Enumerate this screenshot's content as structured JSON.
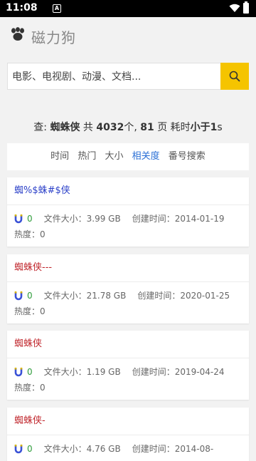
{
  "status": {
    "time": "11:08",
    "notif_glyph": "A"
  },
  "header": {
    "logo_text": "磁力狗",
    "logo_icon": "paw-icon"
  },
  "search": {
    "placeholder": "电影、电视剧、动漫、文档..."
  },
  "summary": {
    "prefix": "查:",
    "query": "蜘蛛侠",
    "mid1": "共",
    "count": "4032",
    "mid2": "个,",
    "pages": "81",
    "mid3": "页 耗时",
    "time_label": "小于1",
    "suffix": "s"
  },
  "tabs": [
    {
      "label": "时间"
    },
    {
      "label": "热门"
    },
    {
      "label": "大小"
    },
    {
      "label": "相关度",
      "active": true
    },
    {
      "label": "番号搜索"
    }
  ],
  "results": [
    {
      "title": "蜘%$蛛#$侠",
      "title_color": "#2a3fc8",
      "count": "0",
      "size": "文件大小：3.99 GB",
      "created": "创建时间：2014-01-19",
      "heat": "热度：0"
    },
    {
      "title": "蜘蛛侠---",
      "title_color": "#c0272d",
      "count": "0",
      "size": "文件大小：21.78 GB",
      "created": "创建时间：2020-01-25",
      "heat": "热度：0"
    },
    {
      "title": "蜘蛛侠",
      "title_color": "#c0272d",
      "count": "0",
      "size": "文件大小：1.19 GB",
      "created": "创建时间：2019-04-24",
      "heat": "热度：0"
    },
    {
      "title": "蜘蛛侠-",
      "title_color": "#c0272d",
      "count": "0",
      "size": "文件大小：4.76 GB",
      "created": "创建时间：2014-08-",
      "heat": ""
    }
  ]
}
